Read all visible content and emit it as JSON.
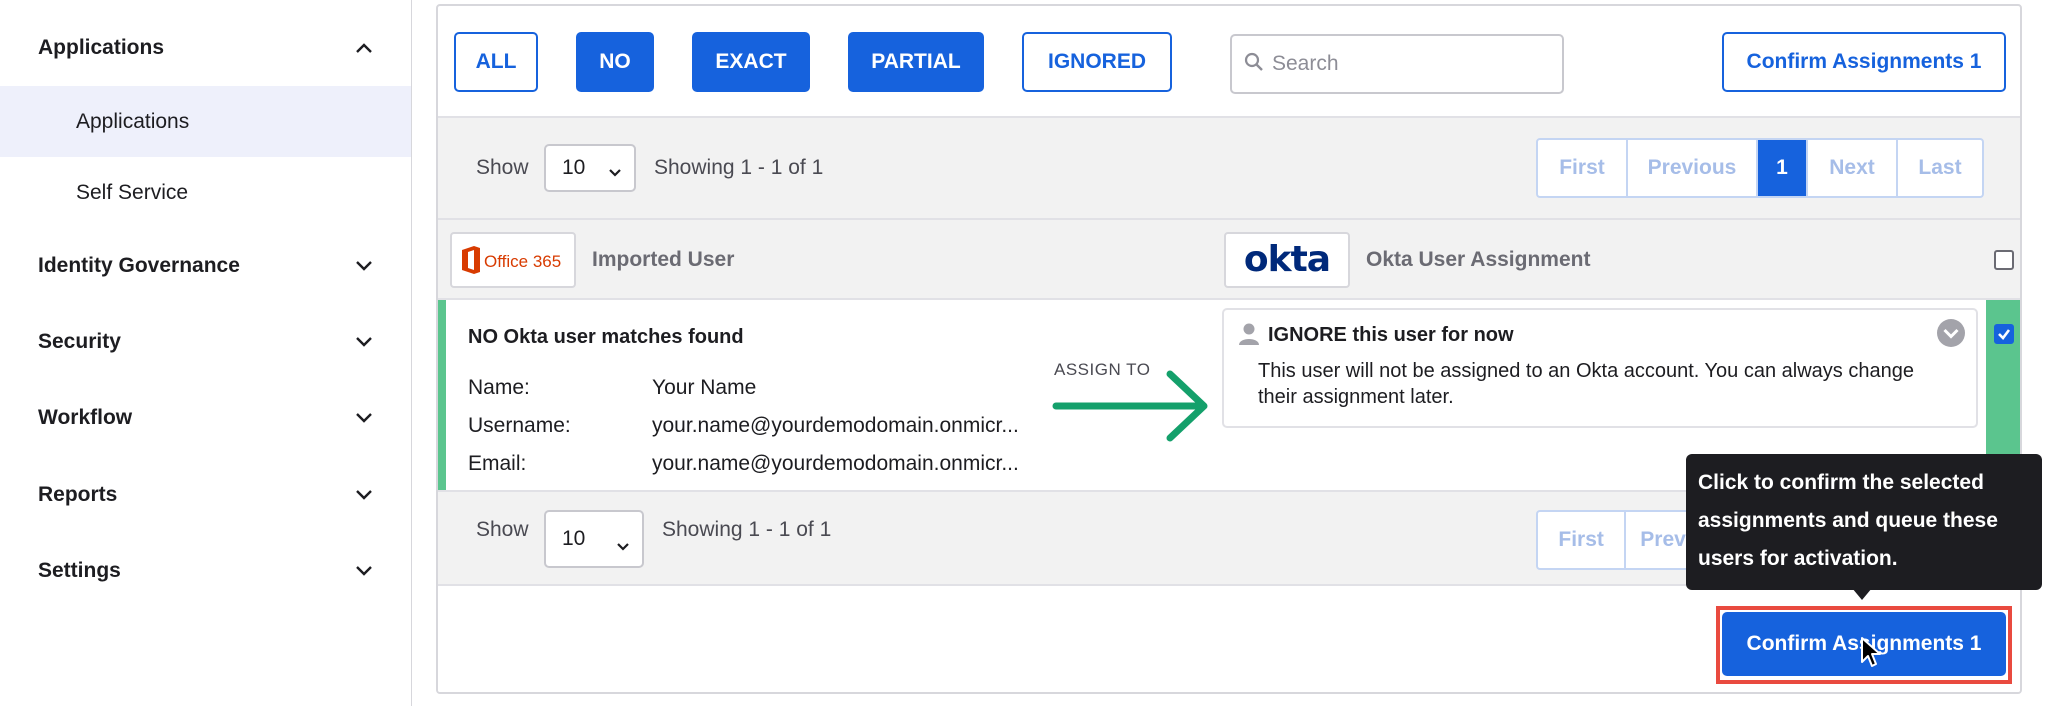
{
  "sidebar": {
    "sections": [
      {
        "label": "Applications",
        "expanded": true
      },
      {
        "label": "Identity Governance",
        "expanded": false
      },
      {
        "label": "Security",
        "expanded": false
      },
      {
        "label": "Workflow",
        "expanded": false
      },
      {
        "label": "Reports",
        "expanded": false
      },
      {
        "label": "Settings",
        "expanded": false
      }
    ],
    "sub_items": [
      {
        "label": "Applications",
        "active": true
      },
      {
        "label": "Self Service",
        "active": false
      }
    ]
  },
  "filters": {
    "all": "ALL",
    "no": "NO",
    "exact": "EXACT",
    "partial": "PARTIAL",
    "ignored": "IGNORED"
  },
  "search": {
    "placeholder": "Search"
  },
  "confirm_top_label": "Confirm Assignments 1",
  "pager_top": {
    "show_label": "Show",
    "page_size": "10",
    "showing": "Showing 1 - 1 of 1",
    "first": "First",
    "previous": "Previous",
    "current": "1",
    "next": "Next",
    "last": "Last"
  },
  "header": {
    "office_logo_text": "Office 365",
    "imported_user": "Imported User",
    "okta_logo_text": "okta",
    "okta_assignment": "Okta User Assignment"
  },
  "user_row": {
    "match_status": "NO Okta user matches found",
    "name_label": "Name:",
    "name_value": "Your Name",
    "username_label": "Username:",
    "username_value": "your.name@yourdemodomain.onmicr...",
    "email_label": "Email:",
    "email_value": "your.name@yourdemodomain.onmicr...",
    "assign_to": "ASSIGN TO",
    "ignore_title": "IGNORE this user for now",
    "ignore_body": "This user will not be assigned to an Okta account. You can always change their assignment later.",
    "checked": true
  },
  "pager_bottom": {
    "show_label": "Show",
    "page_size": "10",
    "showing": "Showing 1 - 1 of 1",
    "first": "First",
    "previous": "Prev"
  },
  "tooltip": {
    "line1": "Click to confirm the selected",
    "line2": "assignments and queue these",
    "line3": "users for activation."
  },
  "confirm_bottom_label": "Confirm Assignments 1",
  "colors": {
    "accent": "#1662dd",
    "success": "#5bc58e",
    "highlight": "#e94a3f",
    "office": "#d83b01",
    "okta": "#00297a"
  }
}
